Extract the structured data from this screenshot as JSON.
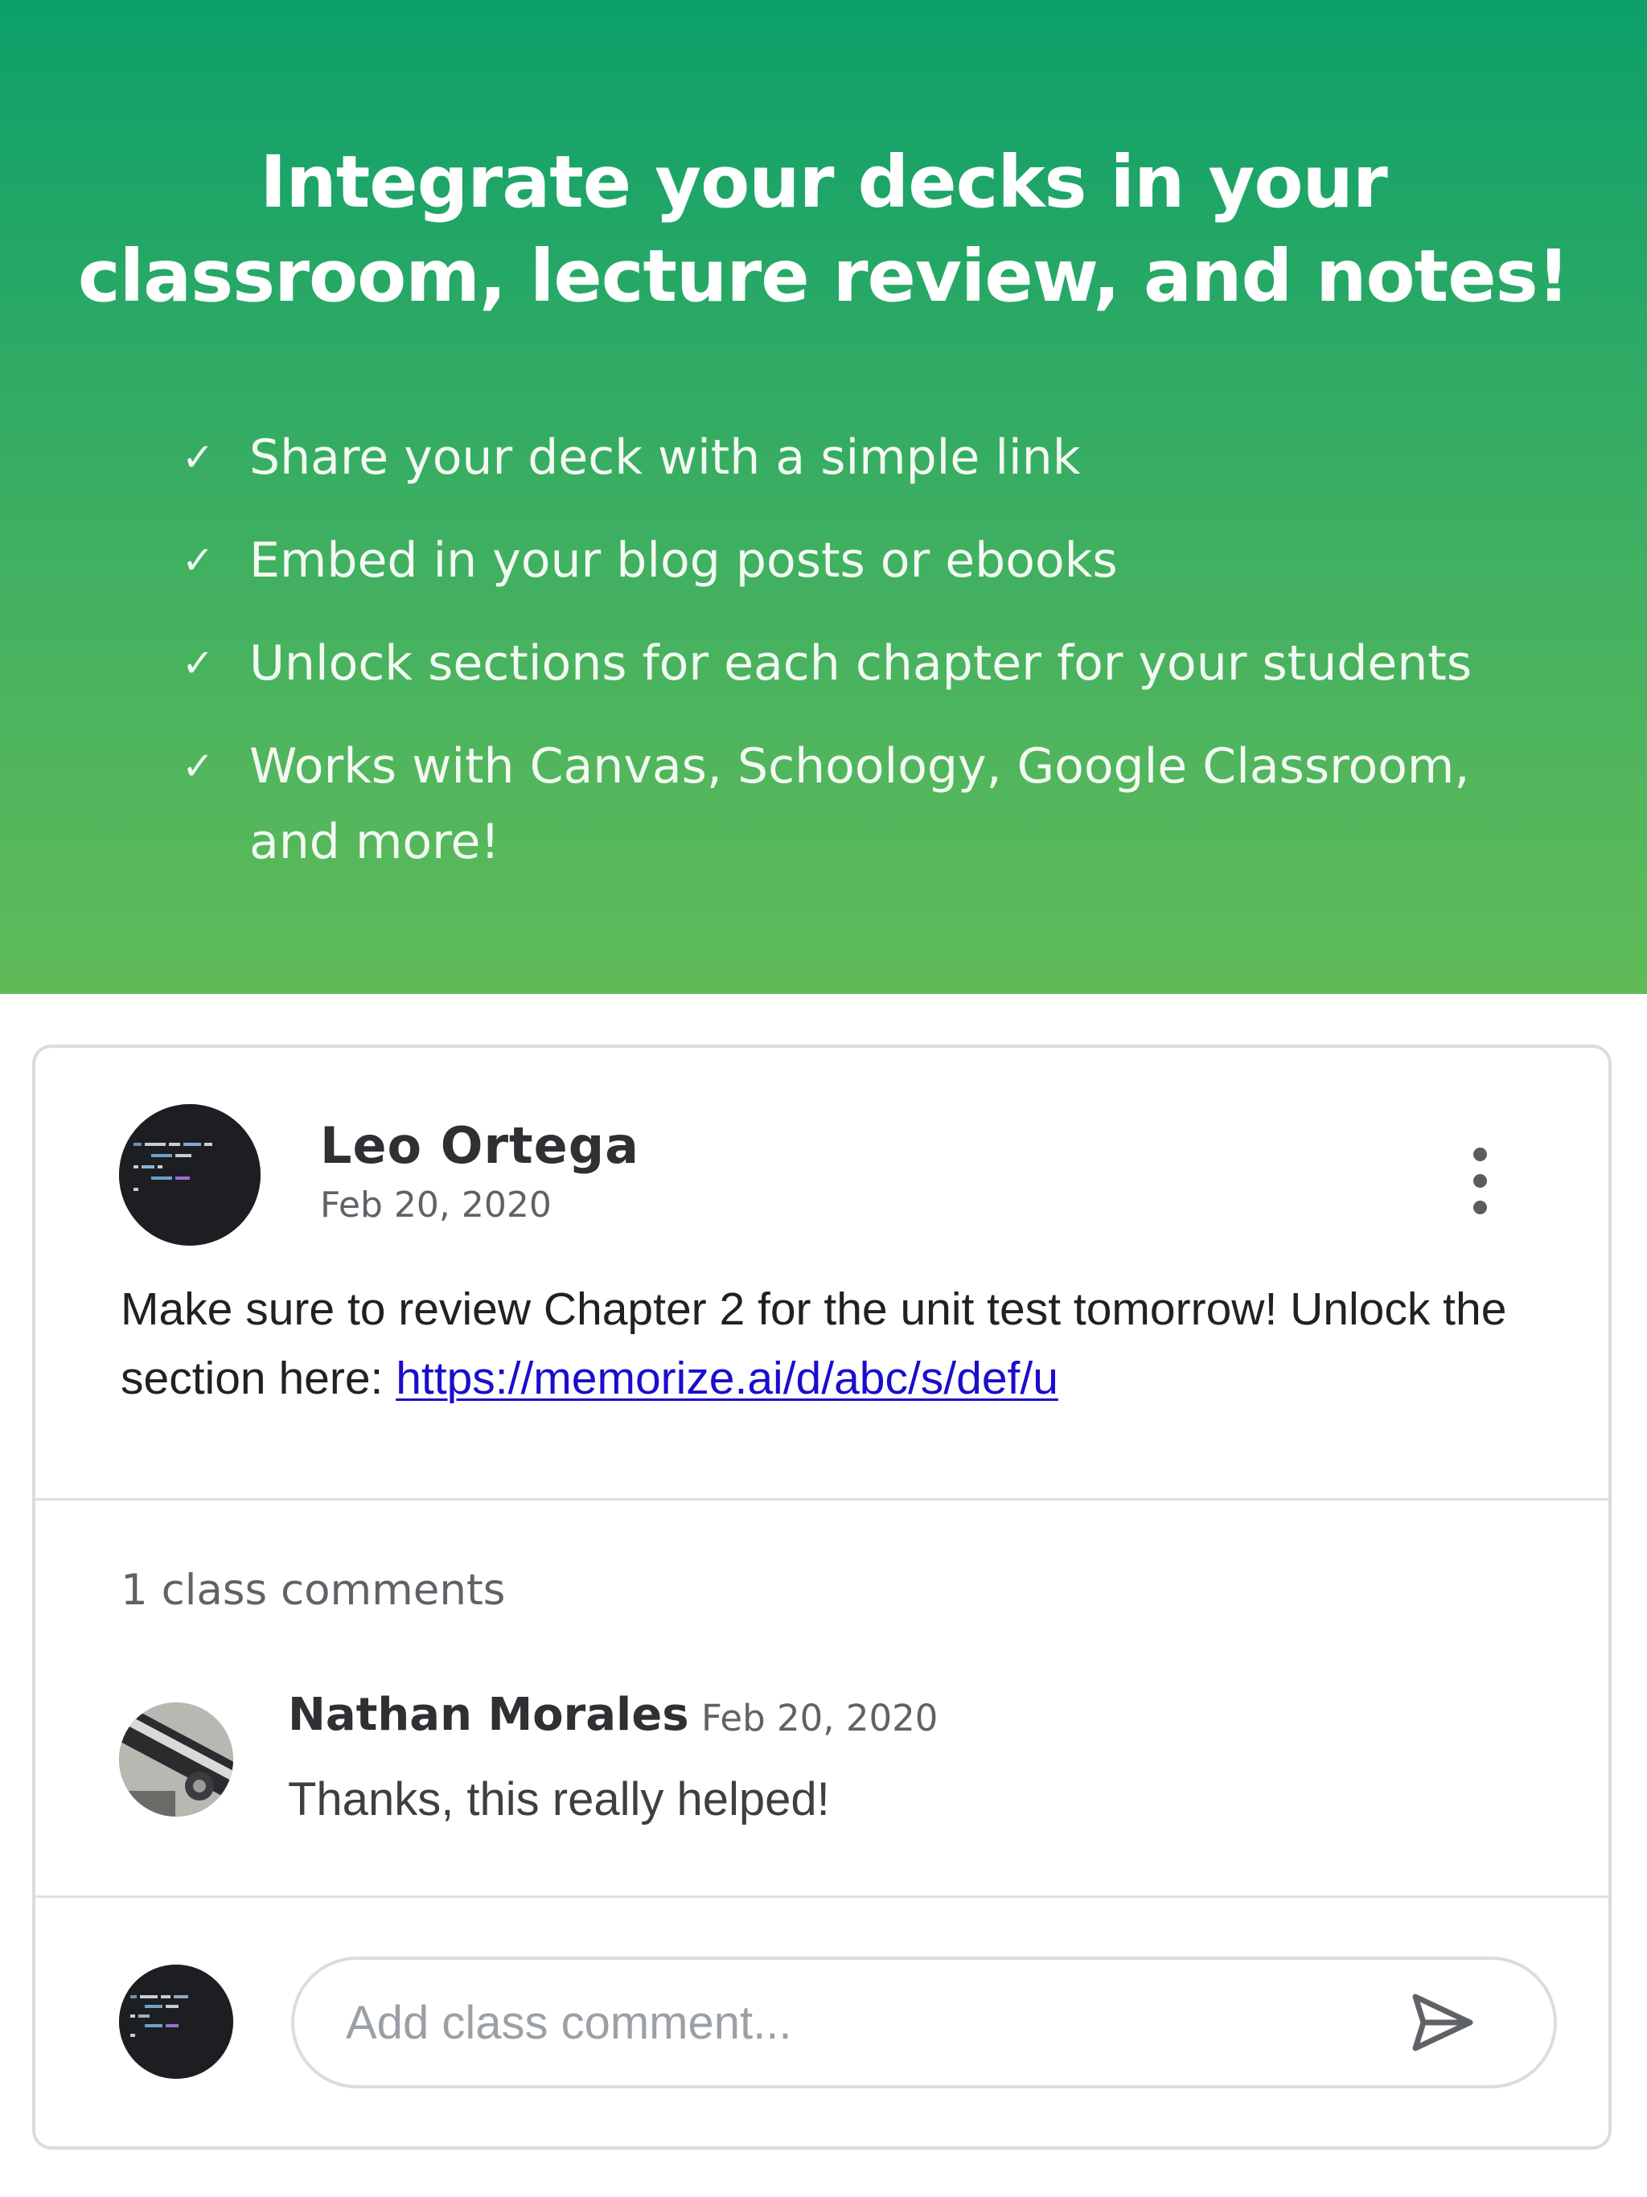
{
  "hero": {
    "title_line1": "Integrate your decks in your",
    "title_line2": "classroom, lecture review, and notes!",
    "check_glyph": "✓",
    "features": [
      "Share your deck with a simple link",
      "Embed in your blog posts or ebooks",
      "Unlock sections for each chapter for your students",
      "Works with Canvas, Schoology, Google Classroom, and more!"
    ]
  },
  "post": {
    "author": "Leo Ortega",
    "date": "Feb 20, 2020",
    "body_text": "Make sure to review Chapter 2 for the unit test tomorrow! Unlock the section here: ",
    "link_text": "https://memorize.ai/d/abc/s/def/u",
    "menu_icon": "more-vert-icon"
  },
  "comments": {
    "count_label": "1 class comments",
    "items": [
      {
        "author": "Nathan Morales",
        "date": "Feb 20, 2020",
        "text": "Thanks, this really helped!"
      }
    ]
  },
  "composer": {
    "placeholder": "Add class comment...",
    "send_icon": "send-icon"
  },
  "colors": {
    "hero_top": "#0ca06a",
    "hero_bottom": "#5fbb58",
    "link": "#1a0dcc",
    "text_primary": "#202124",
    "text_secondary": "#5f6368",
    "border": "#dadce0"
  }
}
